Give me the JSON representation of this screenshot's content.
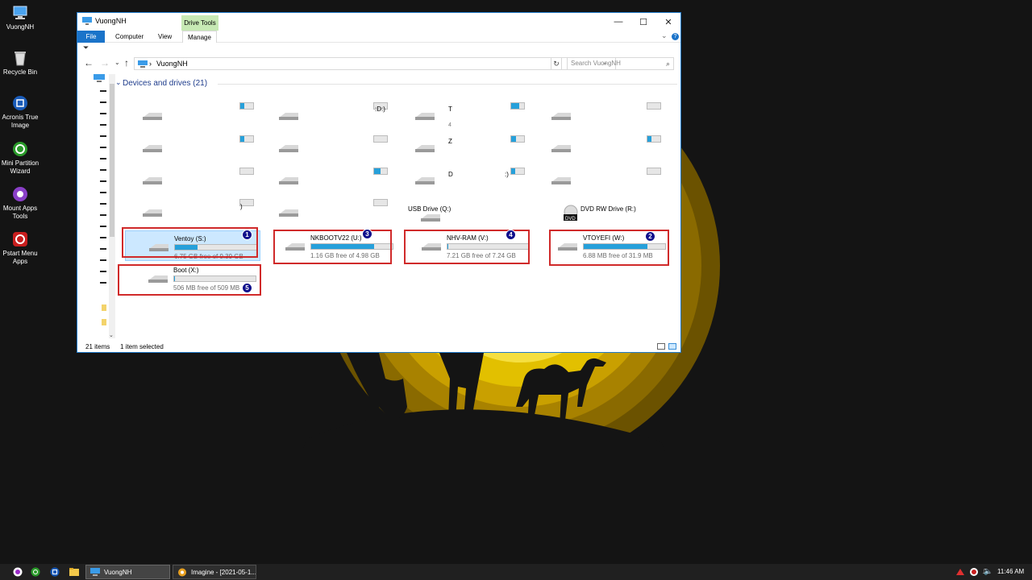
{
  "desktop": {
    "icons": [
      {
        "label": "VuongNH",
        "icon": "computer-icon"
      },
      {
        "label": "Recycle Bin",
        "icon": "recycle-bin-icon"
      },
      {
        "label": "Acronis True Image",
        "icon": "acronis-icon"
      },
      {
        "label": "Mini Partition Wizard",
        "icon": "partition-wizard-icon"
      },
      {
        "label": "Mount Apps Tools",
        "icon": "mount-apps-icon"
      },
      {
        "label": "Pstart Menu Apps",
        "icon": "pstart-icon"
      }
    ]
  },
  "window": {
    "title": "VuongNH",
    "context_tab": "Drive Tools",
    "controls": {
      "minimize": "—",
      "maximize": "☐",
      "close": "✕"
    },
    "tabs": {
      "file": "File",
      "computer": "Computer",
      "view": "View",
      "manage": "Manage"
    },
    "ribbon_expand": "⌄",
    "help": "?",
    "qat": "⏷"
  },
  "nav": {
    "back": "←",
    "forward": "→",
    "recent": "⌄",
    "up": "↑",
    "separator": "›",
    "address": "VuongNH",
    "address_drop": "⌄",
    "refresh": "↻",
    "search_placeholder": "Search VuongNH",
    "search_icon": "⌕"
  },
  "content": {
    "group_header": "Devices and drives (21)",
    "fragments": {
      "d": ":D:)",
      "t": "T",
      "four": "4",
      "z": "Z",
      "paren": ")",
      "dcolon": "D",
      "colon": ":)"
    },
    "labeled_drives": [
      {
        "name": "USB Drive (Q:)"
      },
      {
        "name": "DVD RW Drive (R:)",
        "badge": "DVD"
      }
    ],
    "highlighted": [
      {
        "number": "1",
        "name": "Ventoy (S:)",
        "free": "6.75 GB free of 9.39 GB",
        "used_fraction": 0.28,
        "selected": true
      },
      {
        "number": "3",
        "name": "NKBOOTV22 (U:)",
        "free": "1.16 GB free of 4.98 GB",
        "used_fraction": 0.77,
        "selected": false
      },
      {
        "number": "4",
        "name": "NHV-RAM (V:)",
        "free": "7.21 GB free of 7.24 GB",
        "used_fraction": 0.01,
        "selected": false
      },
      {
        "number": "2",
        "name": "VTOYEFI (W:)",
        "free": "6.88 MB free of 31.9 MB",
        "used_fraction": 0.78,
        "selected": false
      },
      {
        "number": "5",
        "name": "Boot (X:)",
        "free": "506 MB free of 509 MB",
        "used_fraction": 0.01,
        "selected": false
      }
    ]
  },
  "status": {
    "items": "21 items",
    "selected": "1 item selected"
  },
  "taskbar": {
    "explorer_label": "VuongNH",
    "imagine_label": "Imagine - [2021-05-1...",
    "time": "11:46 AM"
  },
  "colors": {
    "accent": "#1a73c9",
    "highlight_box": "#d02a2a",
    "badge": "#10108c",
    "usage_bar": "#26a0da"
  }
}
